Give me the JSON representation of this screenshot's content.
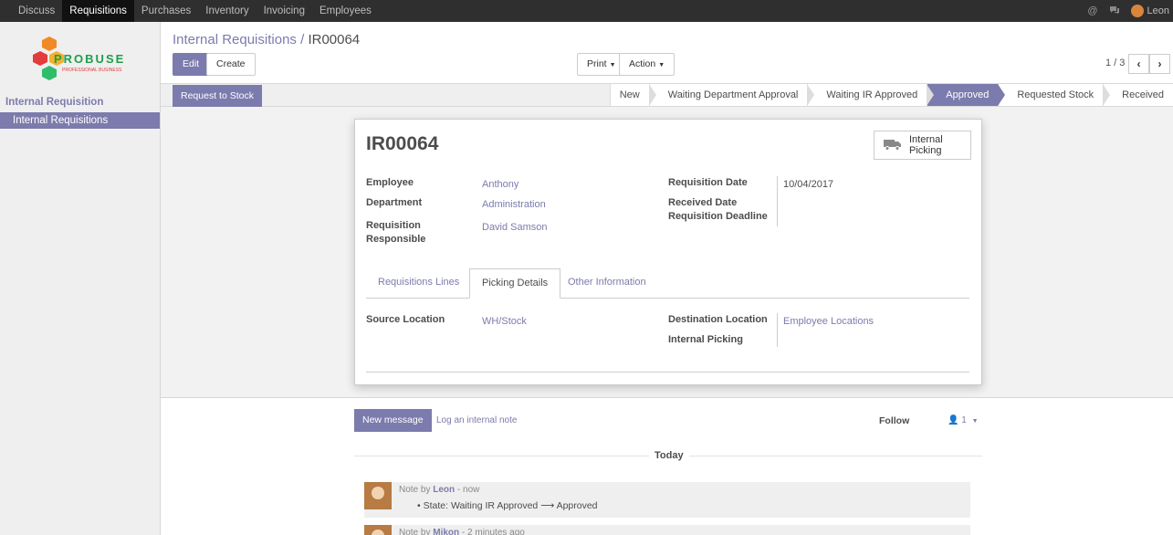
{
  "topbar": {
    "menu": [
      "Discuss",
      "Requisitions",
      "Purchases",
      "Inventory",
      "Invoicing",
      "Employees"
    ],
    "active_menu": "Requisitions",
    "user_name": "Leon"
  },
  "sidebar": {
    "logo_text": "PROBUSE",
    "logo_tagline": "PROFESSIONAL BUSINESS",
    "section_title": "Internal Requisition",
    "item": "Internal Requisitions"
  },
  "breadcrumb": {
    "parent": "Internal Requisitions",
    "separator": "/",
    "current": "IR00064"
  },
  "buttons": {
    "edit": "Edit",
    "create": "Create",
    "print": "Print",
    "action": "Action"
  },
  "pager": {
    "value": "1 / 3",
    "prev": "‹",
    "next": "›"
  },
  "statusbar": {
    "action_button": "Request to Stock",
    "stages": [
      "New",
      "Waiting Department Approval",
      "Waiting IR Approved",
      "Approved",
      "Requested Stock",
      "Received"
    ],
    "active_stage": "Approved"
  },
  "form": {
    "title": "IR00064",
    "smart_button": "Internal Picking",
    "employee_label": "Employee",
    "employee_value": "Anthony",
    "department_label": "Department",
    "department_value": "Administration",
    "responsible_label_1": "Requisition",
    "responsible_label_2": "Responsible",
    "responsible_value": "David Samson",
    "req_date_label": "Requisition Date",
    "req_date_value": "10/04/2017",
    "received_date_label": "Received Date",
    "deadline_label": "Requisition Deadline",
    "tabs": [
      "Requisitions Lines",
      "Picking Details",
      "Other Information"
    ],
    "active_tab": "Picking Details",
    "source_label": "Source Location",
    "source_value": "WH/Stock",
    "dest_label": "Destination Location",
    "dest_value": "Employee Locations",
    "internal_picking_label": "Internal Picking"
  },
  "chatter": {
    "new_message": "New message",
    "log_note": "Log an internal note",
    "follow": "Follow",
    "followers": "1",
    "today": "Today",
    "messages": [
      {
        "prefix": "Note by",
        "author": "Leon",
        "time": "- now",
        "body": "State: Waiting IR Approved ⟶ Approved"
      },
      {
        "prefix": "Note by",
        "author": "Mikon",
        "time": "- 2 minutes ago",
        "body": ""
      }
    ]
  },
  "colors": {
    "brand": "#7c7bad",
    "topbar": "#2f2f2f",
    "sidebar": "#efefef"
  }
}
